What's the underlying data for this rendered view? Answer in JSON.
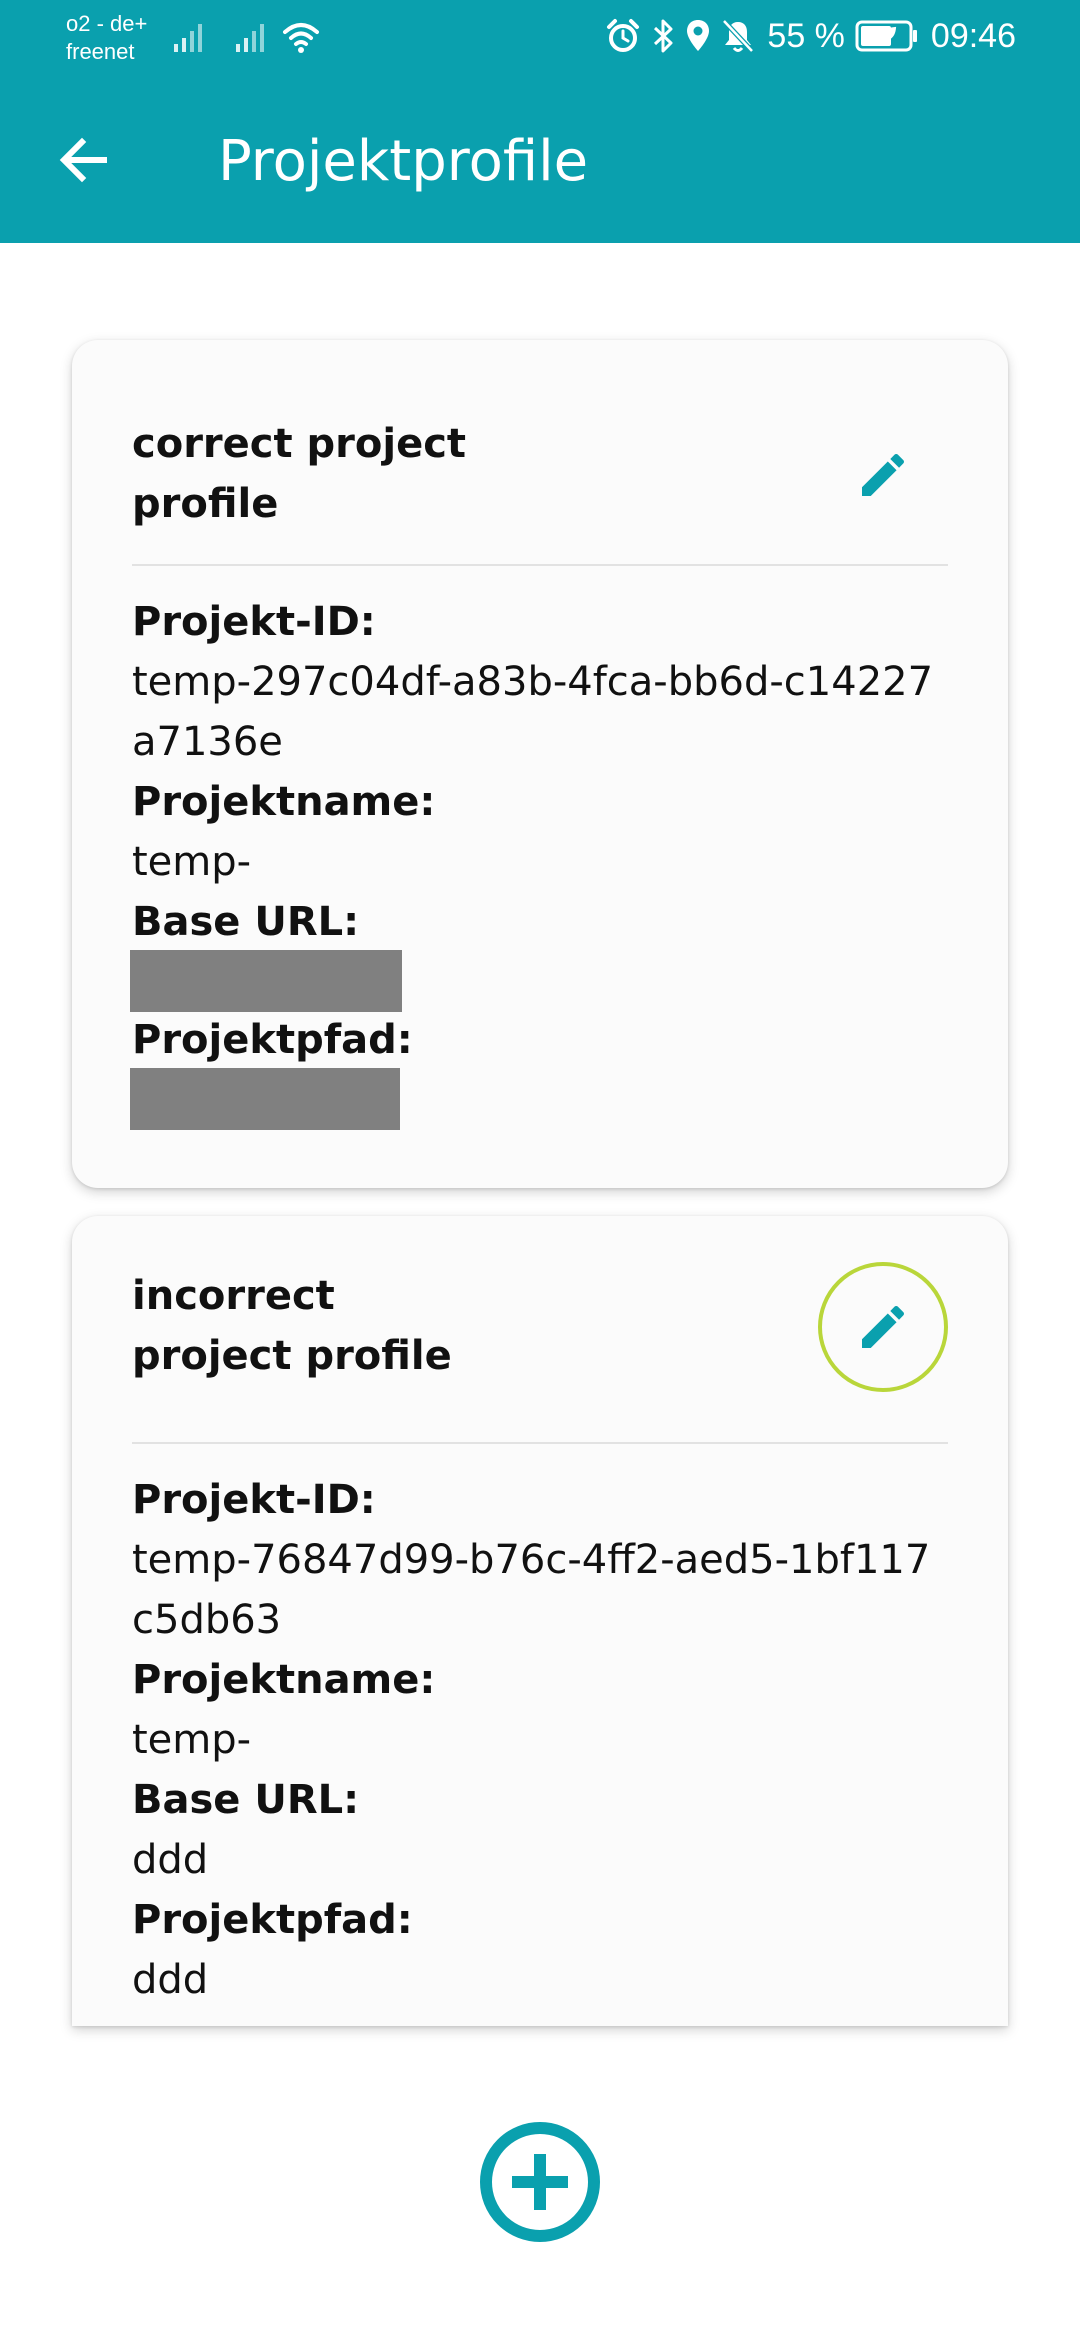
{
  "status_bar": {
    "carrier_line1": "o2 - de+",
    "carrier_line2": "freenet",
    "battery_percent": "55 %",
    "time": "09:46",
    "icons": [
      "signal-icon",
      "signal-icon",
      "wifi-icon",
      "alarm-icon",
      "bluetooth-icon",
      "location-icon",
      "mute-icon",
      "battery-icon"
    ]
  },
  "appbar": {
    "title": "Projektprofile",
    "back_icon": "arrow-back-icon",
    "color": "#0aa0ae"
  },
  "profiles": [
    {
      "title": "correct project\nprofile",
      "edit_icon": "pencil-icon",
      "fields": {
        "project_id_label": "Projekt-ID:",
        "project_id": "temp-297c04df-a83b-4fca-bb6d-c14227a7136e",
        "project_name_label": "Projektname:",
        "project_name": "temp-",
        "base_url_label": "Base URL:",
        "base_url": "",
        "project_path_label": "Projektpfad:",
        "project_path": ""
      }
    },
    {
      "title": "incorrect\nproject profile",
      "edit_icon": "pencil-icon",
      "fields": {
        "project_id_label": "Projekt-ID:",
        "project_id": "temp-76847d99-b76c-4ff2-aed5-1bf117c5db63",
        "project_name_label": "Projektname:",
        "project_name": "temp-",
        "base_url_label": "Base URL:",
        "base_url": "ddd",
        "project_path_label": "Projektpfad:",
        "project_path": "ddd"
      }
    }
  ],
  "fab": {
    "icon": "add-circle-icon",
    "color": "#0aa0ae"
  },
  "colors": {
    "accent": "#0aa0ae",
    "focus_ring": "#b9d63a",
    "redaction": "#808080"
  }
}
